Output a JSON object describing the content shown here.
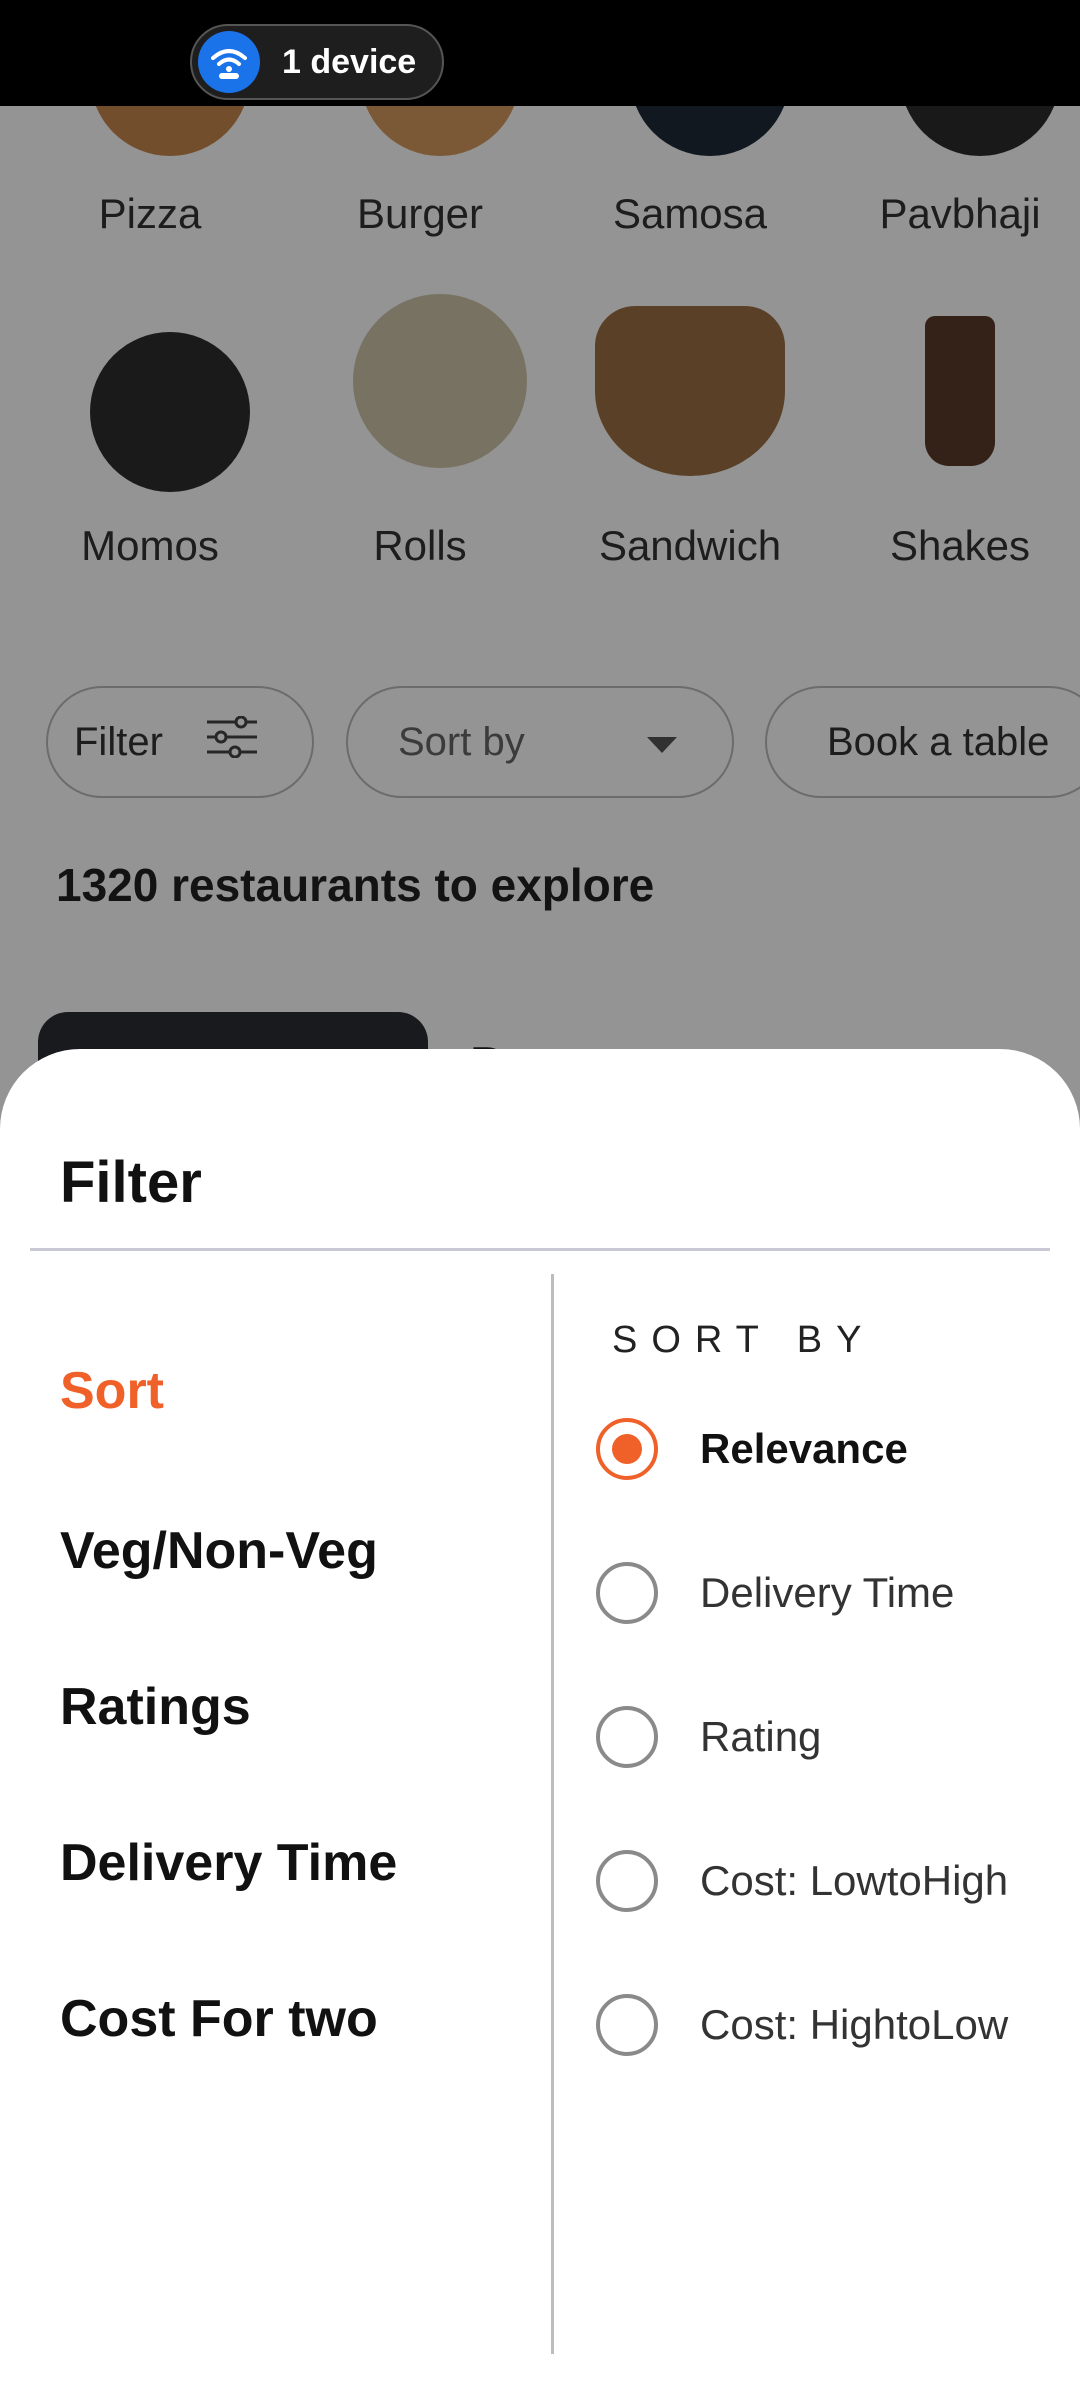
{
  "status_bar": {
    "device_label": "1 device"
  },
  "categories": [
    {
      "label": "Pizza"
    },
    {
      "label": "Burger"
    },
    {
      "label": "Samosa"
    },
    {
      "label": "Pavbhaji"
    },
    {
      "label": "Momos"
    },
    {
      "label": "Rolls"
    },
    {
      "label": "Sandwich"
    },
    {
      "label": "Shakes"
    }
  ],
  "chips": {
    "filter": "Filter",
    "sort_by": "Sort by",
    "book_table": "Book a table"
  },
  "restaurants_count_text": "1320 restaurants to explore",
  "card": {
    "title_partial": "D"
  },
  "sheet": {
    "title": "Filter",
    "categories": [
      {
        "label": "Sort",
        "active": true
      },
      {
        "label": "Veg/Non-Veg",
        "active": false
      },
      {
        "label": "Ratings",
        "active": false
      },
      {
        "label": "Delivery Time",
        "active": false
      },
      {
        "label": "Cost For two",
        "active": false
      }
    ],
    "sort_heading": "SORT BY",
    "options": [
      {
        "label": "Relevance",
        "selected": true
      },
      {
        "label": "Delivery Time",
        "selected": false
      },
      {
        "label": "Rating",
        "selected": false
      },
      {
        "label": "Cost: LowtoHigh",
        "selected": false
      },
      {
        "label": "Cost: HightoLow",
        "selected": false
      }
    ]
  },
  "colors": {
    "accent": "#f06029",
    "overlay": "rgba(0,0,0,0.42)",
    "wifi_badge": "#1a73e8"
  }
}
